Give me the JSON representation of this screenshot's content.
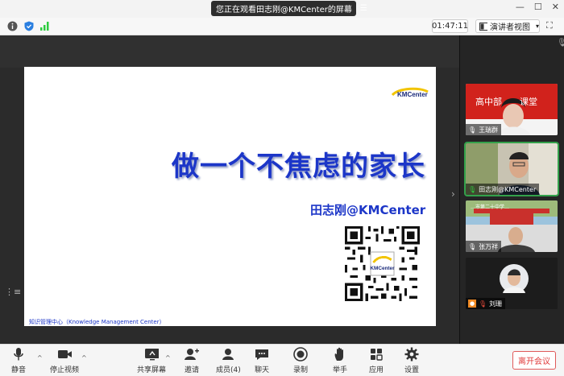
{
  "titlebar": {
    "title": "您正在观看田志刚@KMCenter的屏幕",
    "menu_icon": "hamburger-icon"
  },
  "infobar": {
    "timer": "01:47:11",
    "view_button": "演讲者视图"
  },
  "slide": {
    "logo": "KMCenter",
    "title": "做一个不焦虑的家长",
    "subtitle": "田志刚@KMCenter",
    "qr_logo": "KMCenter",
    "footer": "知识管理中心（Knowledge Management Center）"
  },
  "participants": [
    {
      "name": "王瑞群",
      "banner": "高中部　　课堂",
      "mic": "on"
    },
    {
      "name": "田志刚@KMCenter",
      "mic": "speaking"
    },
    {
      "name": "张万祥",
      "banner": "…市第二十中学…",
      "mic": "on"
    },
    {
      "name": "刘珊",
      "mic": "muted"
    }
  ],
  "toolbar": {
    "mute": "静音",
    "stop_video": "停止视频",
    "share": "共享屏幕",
    "invite": "邀请",
    "participants": "成员(4)",
    "chat": "聊天",
    "record": "录制",
    "raise_hand": "举手",
    "apps": "应用",
    "settings": "设置",
    "leave": "离开会议"
  },
  "colors": {
    "accent_blue": "#1c36c8",
    "active_green": "#33a14b",
    "leave_red": "#e03b3b"
  }
}
